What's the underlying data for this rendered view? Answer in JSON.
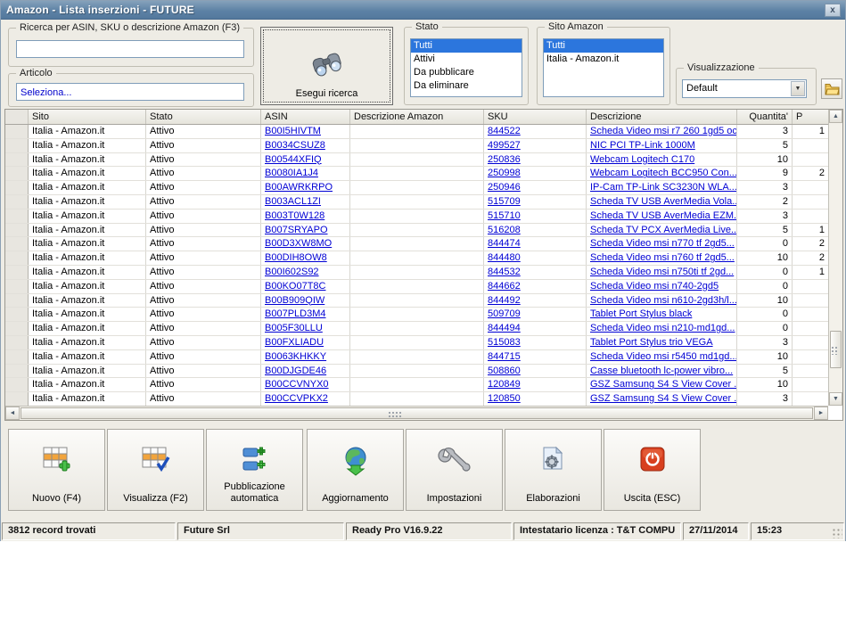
{
  "window": {
    "title": "Amazon - Lista inserzioni - FUTURE",
    "close_label": "x"
  },
  "search": {
    "group_label": "Ricerca per ASIN, SKU o descrizione Amazon (F3)",
    "value": ""
  },
  "articolo": {
    "group_label": "Articolo",
    "value": "Seleziona..."
  },
  "esegui": {
    "label": "Esegui ricerca",
    "icon": "binoculars-icon"
  },
  "stato": {
    "group_label": "Stato",
    "items": [
      "Tutti",
      "Attivi",
      "Da pubblicare",
      "Da eliminare"
    ],
    "selected": "Tutti"
  },
  "sito_amazon": {
    "group_label": "Sito Amazon",
    "items": [
      "Tutti",
      "Italia - Amazon.it"
    ],
    "selected": "Tutti"
  },
  "visualizzazione": {
    "group_label": "Visualizzazione",
    "value": "Default",
    "folder_icon": "folder-icon"
  },
  "table": {
    "columns": {
      "sito": "Sito",
      "stato": "Stato",
      "asin": "ASIN",
      "desc_amazon": "Descrizione Amazon",
      "sku": "SKU",
      "descrizione": "Descrizione",
      "quantita": "Quantita'",
      "extra": "P"
    },
    "rows": [
      {
        "sito": "Italia - Amazon.it",
        "stato": "Attivo",
        "asin": "B00I5HIVTM",
        "desc_amazon": "",
        "sku": "844522",
        "descrizione": "Scheda Video msi r7 260 1gd5 oc",
        "quantita": "3",
        "extra": "1"
      },
      {
        "sito": "Italia - Amazon.it",
        "stato": "Attivo",
        "asin": "B0034CSUZ8",
        "desc_amazon": "",
        "sku": "499527",
        "descrizione": "NIC PCI TP-Link 1000M",
        "quantita": "5",
        "extra": ""
      },
      {
        "sito": "Italia - Amazon.it",
        "stato": "Attivo",
        "asin": "B00544XFIQ",
        "desc_amazon": "",
        "sku": "250836",
        "descrizione": "Webcam Logitech C170",
        "quantita": "10",
        "extra": ""
      },
      {
        "sito": "Italia - Amazon.it",
        "stato": "Attivo",
        "asin": "B0080IA1J4",
        "desc_amazon": "",
        "sku": "250998",
        "descrizione": "Webcam Logitech BCC950 Con...",
        "quantita": "9",
        "extra": "2"
      },
      {
        "sito": "Italia - Amazon.it",
        "stato": "Attivo",
        "asin": "B00AWRKRPO",
        "desc_amazon": "",
        "sku": "250946",
        "descrizione": "IP-Cam TP-Link SC3230N WLA...",
        "quantita": "3",
        "extra": ""
      },
      {
        "sito": "Italia - Amazon.it",
        "stato": "Attivo",
        "asin": "B003ACL1ZI",
        "desc_amazon": "",
        "sku": "515709",
        "descrizione": "Scheda TV USB AverMedia Vola...",
        "quantita": "2",
        "extra": ""
      },
      {
        "sito": "Italia - Amazon.it",
        "stato": "Attivo",
        "asin": "B003T0W128",
        "desc_amazon": "",
        "sku": "515710",
        "descrizione": "Scheda TV USB AverMedia EZM...",
        "quantita": "3",
        "extra": ""
      },
      {
        "sito": "Italia - Amazon.it",
        "stato": "Attivo",
        "asin": "B007SRYAPO",
        "desc_amazon": "",
        "sku": "516208",
        "descrizione": "Scheda TV PCX AverMedia Live...",
        "quantita": "5",
        "extra": "1"
      },
      {
        "sito": "Italia - Amazon.it",
        "stato": "Attivo",
        "asin": "B00D3XW8MO",
        "desc_amazon": "",
        "sku": "844474",
        "descrizione": "Scheda Video msi n770 tf 2gd5...",
        "quantita": "0",
        "extra": "2"
      },
      {
        "sito": "Italia - Amazon.it",
        "stato": "Attivo",
        "asin": "B00DIH8OW8",
        "desc_amazon": "",
        "sku": "844480",
        "descrizione": "Scheda Video msi n760 tf 2gd5...",
        "quantita": "10",
        "extra": "2"
      },
      {
        "sito": "Italia - Amazon.it",
        "stato": "Attivo",
        "asin": "B00I602S92",
        "desc_amazon": "",
        "sku": "844532",
        "descrizione": "Scheda Video msi n750ti tf 2gd...",
        "quantita": "0",
        "extra": "1"
      },
      {
        "sito": "Italia - Amazon.it",
        "stato": "Attivo",
        "asin": "B00KO07T8C",
        "desc_amazon": "",
        "sku": "844662",
        "descrizione": "Scheda Video msi n740-2gd5",
        "quantita": "0",
        "extra": ""
      },
      {
        "sito": "Italia - Amazon.it",
        "stato": "Attivo",
        "asin": "B00B909QIW",
        "desc_amazon": "",
        "sku": "844492",
        "descrizione": "Scheda Video msi n610-2gd3h/l...",
        "quantita": "10",
        "extra": ""
      },
      {
        "sito": "Italia - Amazon.it",
        "stato": "Attivo",
        "asin": "B007PLD3M4",
        "desc_amazon": "",
        "sku": "509709",
        "descrizione": "Tablet Port Stylus black",
        "quantita": "0",
        "extra": ""
      },
      {
        "sito": "Italia - Amazon.it",
        "stato": "Attivo",
        "asin": "B005F30LLU",
        "desc_amazon": "",
        "sku": "844494",
        "descrizione": "Scheda Video msi n210-md1gd...",
        "quantita": "0",
        "extra": ""
      },
      {
        "sito": "Italia - Amazon.it",
        "stato": "Attivo",
        "asin": "B00FXLIADU",
        "desc_amazon": "",
        "sku": "515083",
        "descrizione": "Tablet Port Stylus trio VEGA",
        "quantita": "3",
        "extra": ""
      },
      {
        "sito": "Italia - Amazon.it",
        "stato": "Attivo",
        "asin": "B0063KHKKY",
        "desc_amazon": "",
        "sku": "844715",
        "descrizione": "Scheda Video msi r5450 md1gd...",
        "quantita": "10",
        "extra": ""
      },
      {
        "sito": "Italia - Amazon.it",
        "stato": "Attivo",
        "asin": "B00DJGDE46",
        "desc_amazon": "",
        "sku": "508860",
        "descrizione": "Casse bluetooth lc-power vibro...",
        "quantita": "5",
        "extra": ""
      },
      {
        "sito": "Italia - Amazon.it",
        "stato": "Attivo",
        "asin": "B00CCVNYX0",
        "desc_amazon": "",
        "sku": "120849",
        "descrizione": "GSZ Samsung S4 S View Cover ...",
        "quantita": "10",
        "extra": ""
      },
      {
        "sito": "Italia - Amazon.it",
        "stato": "Attivo",
        "asin": "B00CCVPKX2",
        "desc_amazon": "",
        "sku": "120850",
        "descrizione": "GSZ Samsung S4 S View Cover ...",
        "quantita": "3",
        "extra": ""
      }
    ]
  },
  "toolbar": {
    "buttons": [
      {
        "label": "Nuovo (F4)",
        "icon": "table-add-icon"
      },
      {
        "label": "Visualizza (F2)",
        "icon": "table-check-icon"
      },
      {
        "label": "Pubblicazione\nautomatica",
        "icon": "publish-auto-icon"
      },
      {
        "label": "Aggiornamento",
        "icon": "globe-download-icon"
      },
      {
        "label": "Impostazioni",
        "icon": "wrench-icon"
      },
      {
        "label": "Elaborazioni",
        "icon": "document-gear-icon"
      },
      {
        "label": "Uscita (ESC)",
        "icon": "power-icon"
      }
    ]
  },
  "statusbar": {
    "records": "3812 record trovati",
    "company": "Future Srl",
    "version": "Ready Pro V16.9.22",
    "license": "Intestatario licenza : T&T COMPU",
    "date": "27/11/2014",
    "time": "15:23"
  }
}
